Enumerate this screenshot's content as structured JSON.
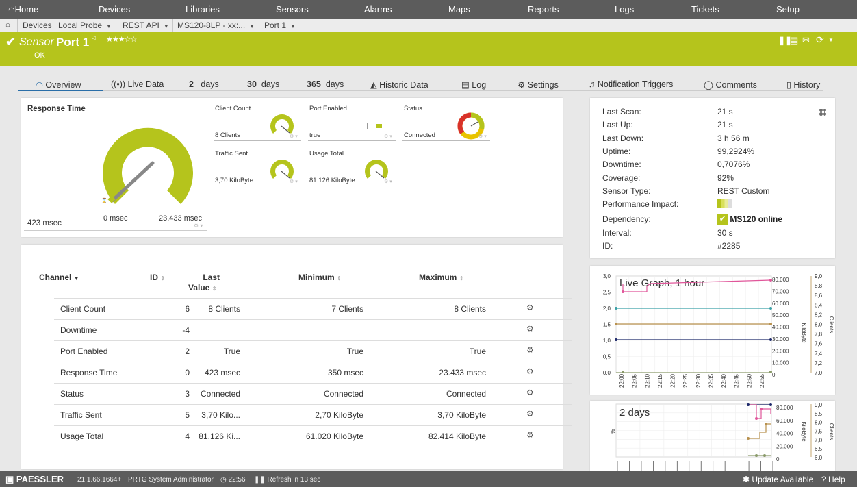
{
  "nav": {
    "home": "Home",
    "items": [
      "Devices",
      "Libraries",
      "Sensors",
      "Alarms",
      "Maps",
      "Reports",
      "Logs",
      "Tickets",
      "Setup"
    ]
  },
  "breadcrumb": [
    "Devices",
    "Local Probe",
    "REST API",
    "MS120-8LP - xx:...",
    "Port 1"
  ],
  "sensor": {
    "type_label": "Sensor",
    "name": "Port 1",
    "status": "OK",
    "stars": "★★★☆☆"
  },
  "tabs": {
    "overview": "Overview",
    "live": "Live Data",
    "days2_num": "2",
    "days2_unit": "days",
    "days30_num": "30",
    "days30_unit": "days",
    "days365_num": "365",
    "days365_unit": "days",
    "historic": "Historic Data",
    "log": "Log",
    "settings": "Settings",
    "notif": "Notification Triggers",
    "comments": "Comments",
    "history": "History"
  },
  "gauges": {
    "main": {
      "label": "Response Time",
      "value": "423 msec",
      "min": "0 msec",
      "max": "23.433 msec"
    },
    "client_count": {
      "label": "Client Count",
      "value": "8 Clients"
    },
    "port_enabled": {
      "label": "Port Enabled",
      "value": "true"
    },
    "status": {
      "label": "Status",
      "value": "Connected"
    },
    "traffic_sent": {
      "label": "Traffic Sent",
      "value": "3,70 KiloByte"
    },
    "usage_total": {
      "label": "Usage Total",
      "value": "81.126 KiloByte"
    }
  },
  "channels": {
    "headers": {
      "channel": "Channel",
      "id": "ID",
      "last1": "Last",
      "last2": "Value",
      "min": "Minimum",
      "max": "Maximum"
    },
    "rows": [
      {
        "name": "Client Count",
        "id": "6",
        "last": "8 Clients",
        "min": "7 Clients",
        "max": "8 Clients"
      },
      {
        "name": "Downtime",
        "id": "-4",
        "last": "",
        "min": "",
        "max": ""
      },
      {
        "name": "Port Enabled",
        "id": "2",
        "last": "True",
        "min": "True",
        "max": "True"
      },
      {
        "name": "Response Time",
        "id": "0",
        "last": "423 msec",
        "min": "350 msec",
        "max": "23.433 msec"
      },
      {
        "name": "Status",
        "id": "3",
        "last": "Connected",
        "min": "Connected",
        "max": "Connected"
      },
      {
        "name": "Traffic Sent",
        "id": "5",
        "last": "3,70 Kilo...",
        "min": "2,70 KiloByte",
        "max": "3,70 KiloByte"
      },
      {
        "name": "Usage Total",
        "id": "4",
        "last": "81.126 Ki...",
        "min": "61.020 KiloByte",
        "max": "82.414 KiloByte"
      }
    ]
  },
  "properties": [
    {
      "label": "Last Scan:",
      "value": "21 s"
    },
    {
      "label": "Last Up:",
      "value": "21 s"
    },
    {
      "label": "Last Down:",
      "value": "3 h 56 m"
    },
    {
      "label": "Uptime:",
      "value": "99,2924%"
    },
    {
      "label": "Downtime:",
      "value": "0,7076%"
    },
    {
      "label": "Coverage:",
      "value": "92%"
    },
    {
      "label": "Sensor Type:",
      "value": "REST Custom"
    },
    {
      "label": "Performance Impact:",
      "value": ""
    },
    {
      "label": "Dependency:",
      "value": "MS120 online"
    },
    {
      "label": "Interval:",
      "value": "30 s"
    },
    {
      "label": "ID:",
      "value": "#2285"
    }
  ],
  "live_graph": {
    "title": "Live Graph, 1 hour",
    "left_ticks": [
      "3,0",
      "2,5",
      "2,0",
      "1,5",
      "1,0",
      "0,5",
      "0,0"
    ],
    "mid_ticks": [
      "80.000",
      "70.000",
      "60.000",
      "50.000",
      "40.000",
      "30.000",
      "20.000",
      "10.000",
      "0"
    ],
    "right_ticks": [
      "9,0",
      "8,8",
      "8,6",
      "8,4",
      "8,2",
      "8,0",
      "7,8",
      "7,6",
      "7,4",
      "7,2",
      "7,0"
    ],
    "x_ticks": [
      "22:00",
      "22:05",
      "22:10",
      "22:15",
      "22:20",
      "22:25",
      "22:30",
      "22:35",
      "22:40",
      "22:45",
      "22:50",
      "22:55"
    ],
    "mid_axis": "KiloByte",
    "right_axis": "Clients"
  },
  "days2_graph": {
    "title": "2 days",
    "left_axis": "%",
    "mid_ticks": [
      "80.000",
      "60.000",
      "40.000",
      "20.000",
      "0"
    ],
    "right_ticks": [
      "9,0",
      "8,5",
      "8,0",
      "7,5",
      "7,0",
      "6,5",
      "6,0"
    ],
    "mid_axis": "KiloByte",
    "right_axis": "Clients"
  },
  "footer": {
    "brand": "PAESSLER",
    "version": "21.1.66.1664+",
    "user": "PRTG System Administrator",
    "time": "22:56",
    "refresh": "Refresh in 13 sec",
    "update": "Update Available",
    "help": "Help"
  },
  "colors": {
    "brand": "#b5c41c",
    "nav": "#5c5c5c",
    "gauge": "#b5c41c"
  }
}
